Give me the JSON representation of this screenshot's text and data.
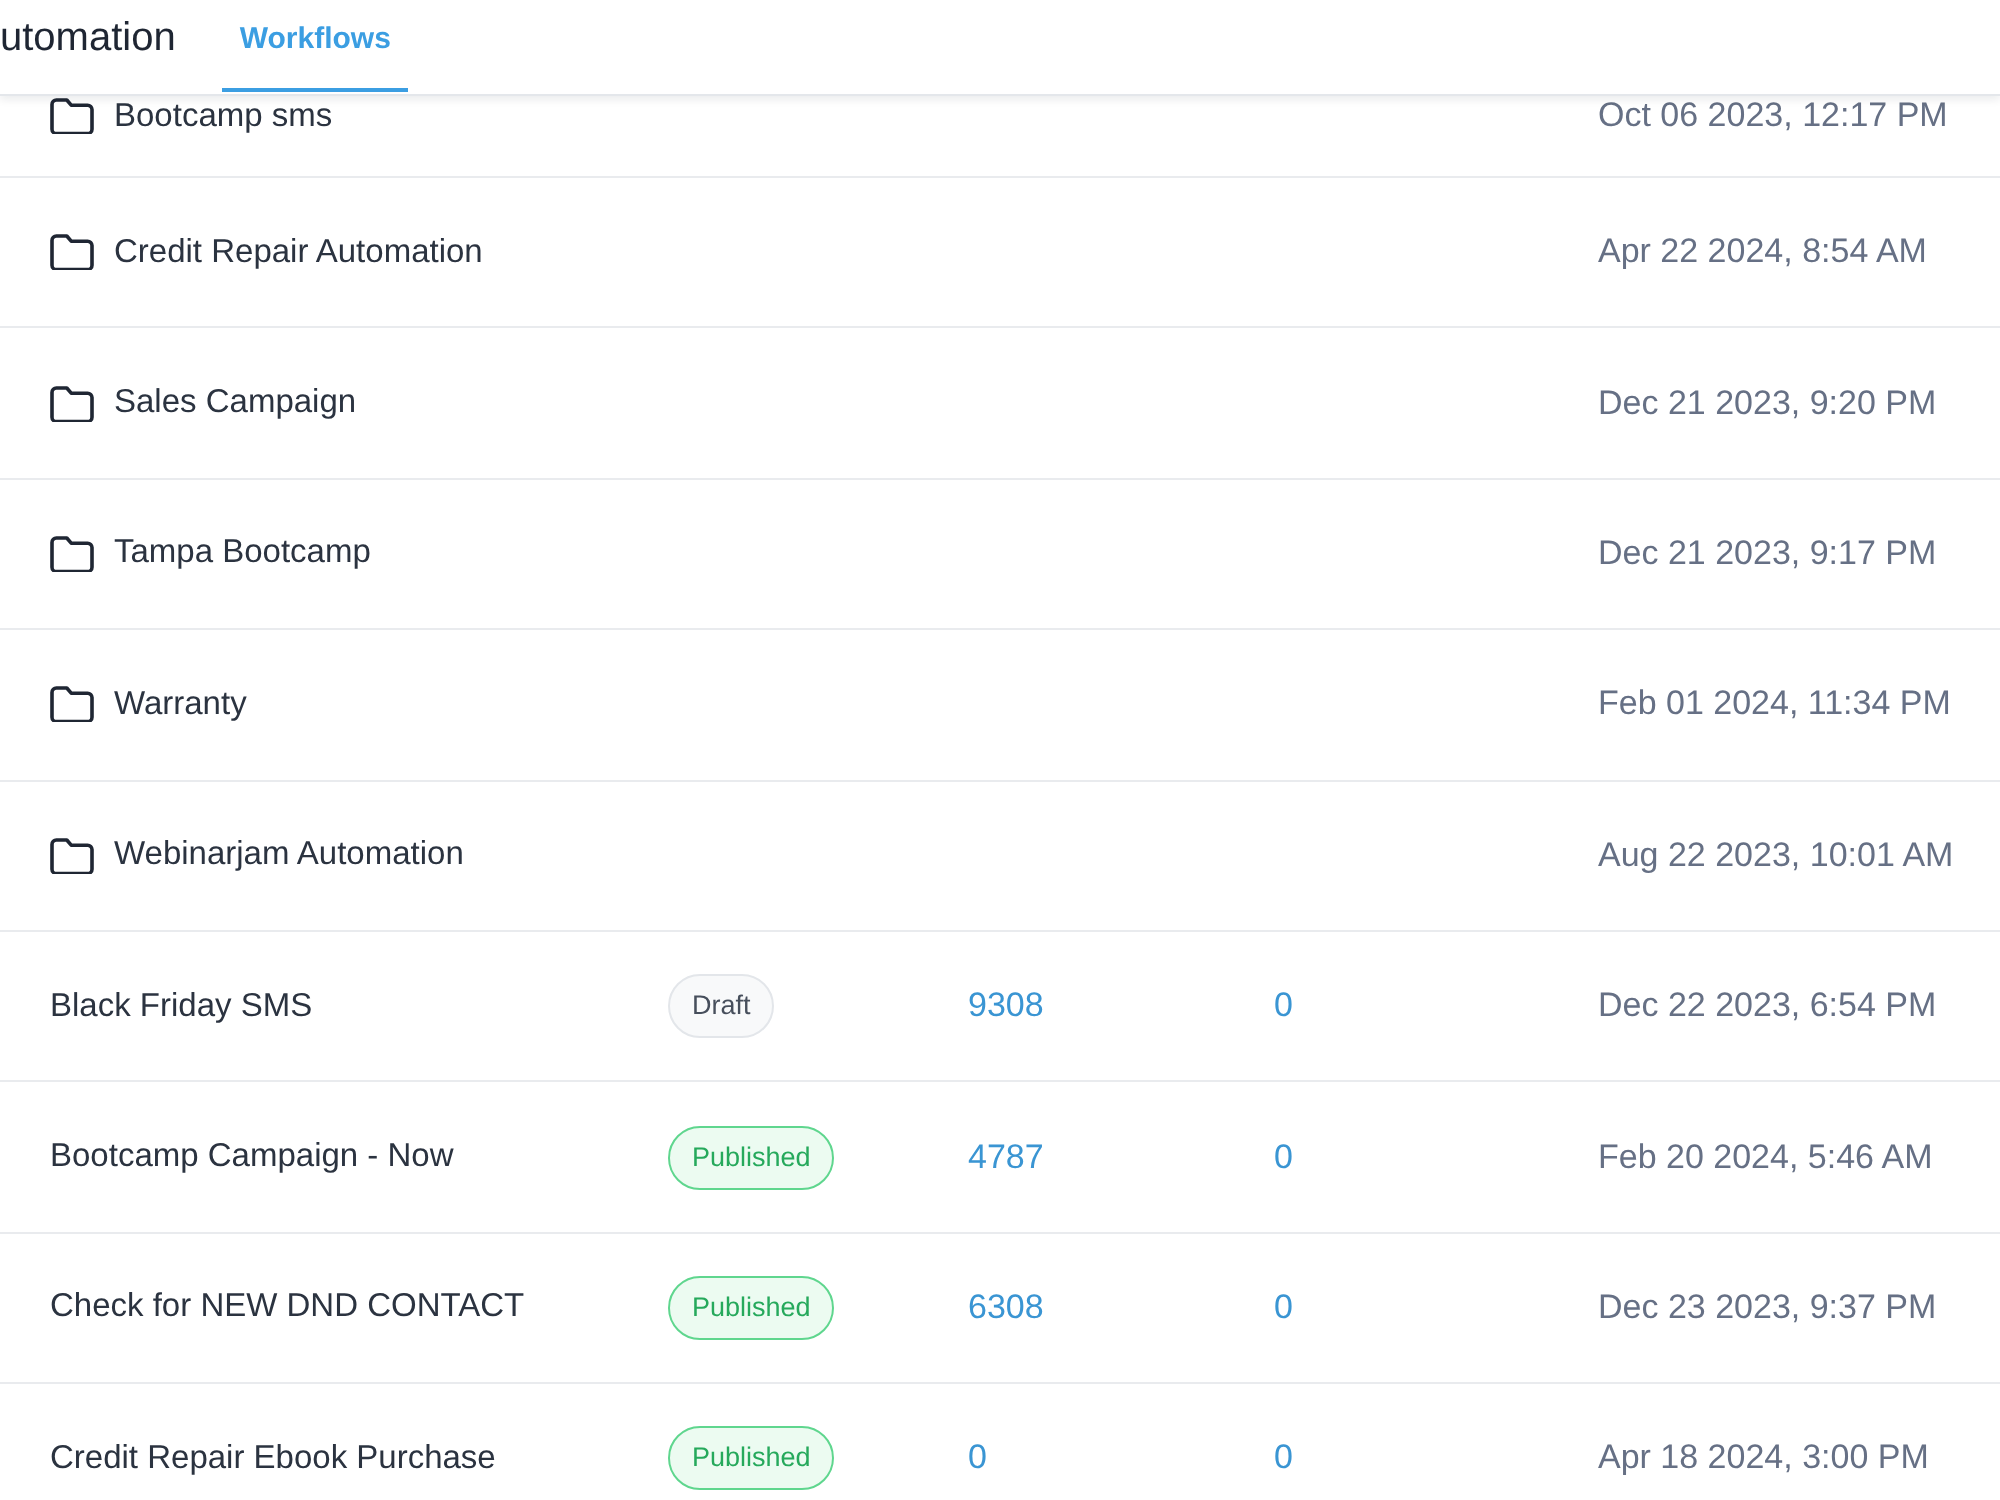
{
  "header": {
    "title": "utomation",
    "tabs": [
      {
        "label": "Workflows",
        "selected": true
      }
    ]
  },
  "table": {
    "rows": [
      {
        "kind": "folder",
        "name": "Bootcamp sms",
        "date": "Oct 06 2023, 12:17 PM"
      },
      {
        "kind": "folder",
        "name": "Credit Repair Automation",
        "date": "Apr 22 2024, 8:54 AM"
      },
      {
        "kind": "folder",
        "name": "Sales Campaign",
        "date": "Dec 21 2023, 9:20 PM"
      },
      {
        "kind": "folder",
        "name": "Tampa Bootcamp",
        "date": "Dec 21 2023, 9:17 PM"
      },
      {
        "kind": "folder",
        "name": "Warranty",
        "date": "Feb 01 2024, 11:34 PM"
      },
      {
        "kind": "folder",
        "name": "Webinarjam Automation",
        "date": "Aug 22 2023, 10:01 AM"
      },
      {
        "kind": "workflow",
        "name": "Black Friday SMS",
        "status": {
          "label": "Draft",
          "kind": "draft"
        },
        "column_3": "9308",
        "column_4": "0",
        "date": "Dec 22 2023, 6:54 PM"
      },
      {
        "kind": "workflow",
        "name": "Bootcamp Campaign - Now",
        "status": {
          "label": "Published",
          "kind": "published"
        },
        "column_3": "4787",
        "column_4": "0",
        "date": "Feb 20 2024, 5:46 AM"
      },
      {
        "kind": "workflow",
        "name": "Check for NEW DND CONTACT",
        "status": {
          "label": "Published",
          "kind": "published"
        },
        "column_3": "6308",
        "column_4": "0",
        "date": "Dec 23 2023, 9:37 PM"
      },
      {
        "kind": "workflow",
        "name": "Credit Repair Ebook Purchase",
        "status": {
          "label": "Published",
          "kind": "published"
        },
        "column_3": "0",
        "column_4": "0",
        "date": "Apr 18 2024, 3:00 PM"
      }
    ]
  }
}
